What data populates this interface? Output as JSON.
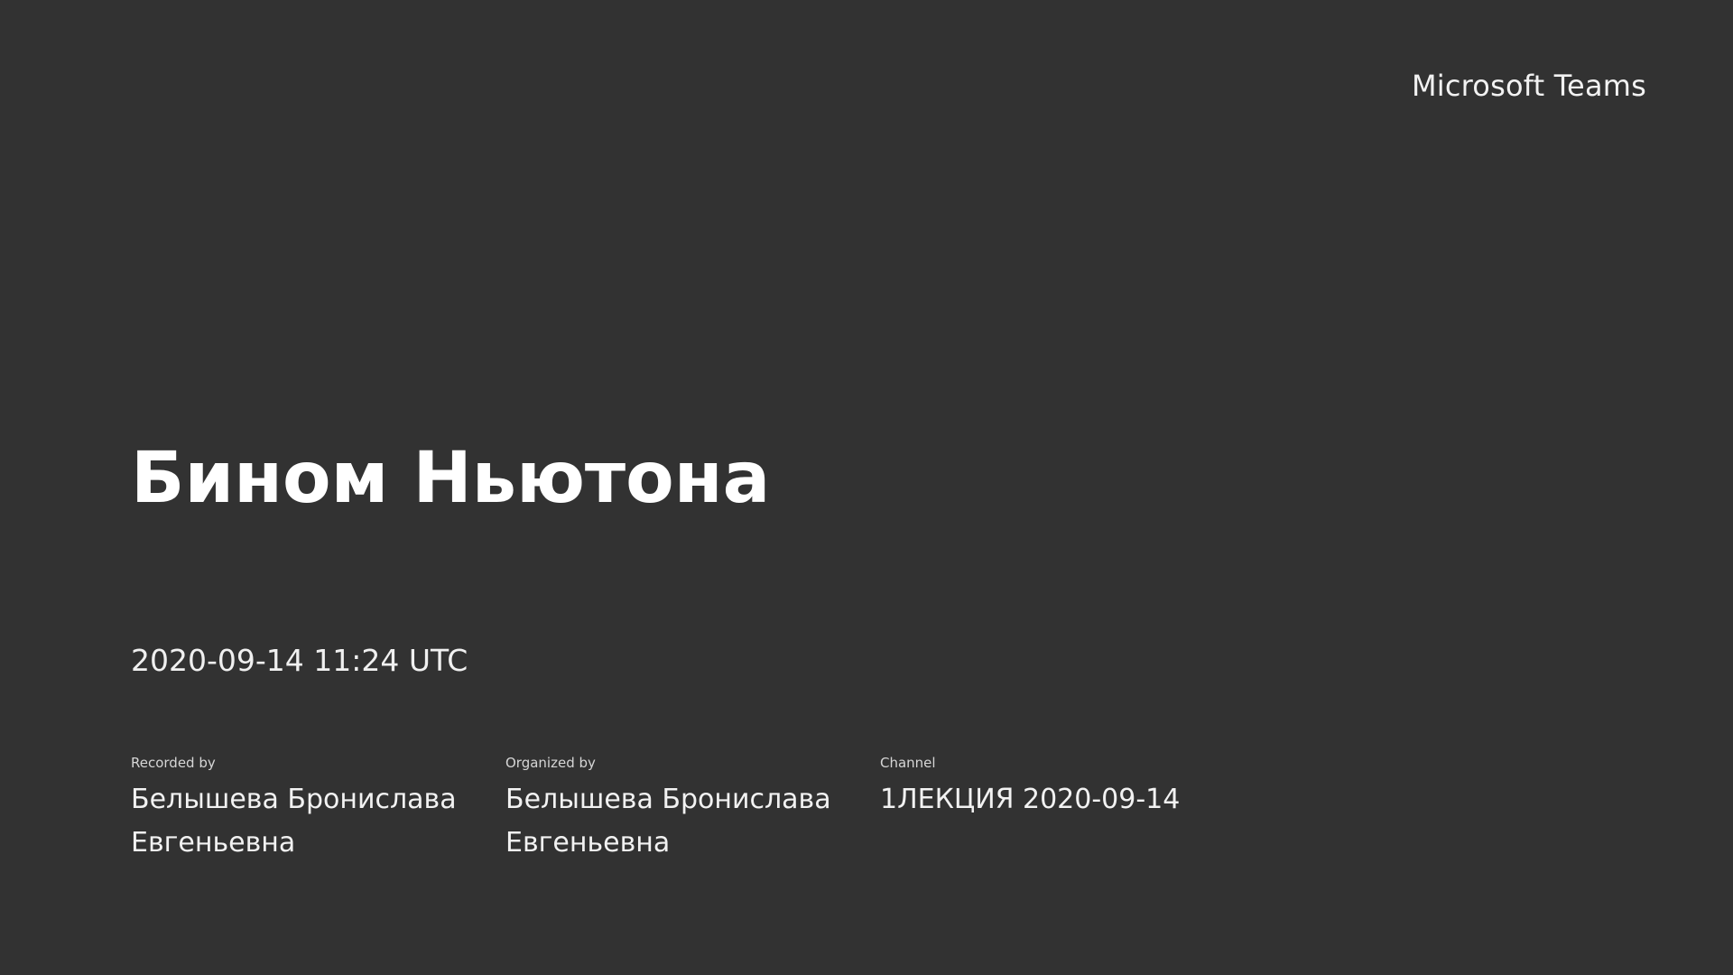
{
  "brand": "Microsoft Teams",
  "meeting": {
    "title": "Бином Ньютона",
    "datetime": "2020-09-14 11:24 UTC"
  },
  "details": {
    "recorded_by_label": "Recorded by",
    "recorded_by_value": "Белышева Бронислава Евгеньевна",
    "organized_by_label": "Organized by",
    "organized_by_value": "Белышева Бронислава Евгеньевна",
    "channel_label": "Channel",
    "channel_value": "1ЛЕКЦИЯ 2020-09-14"
  }
}
